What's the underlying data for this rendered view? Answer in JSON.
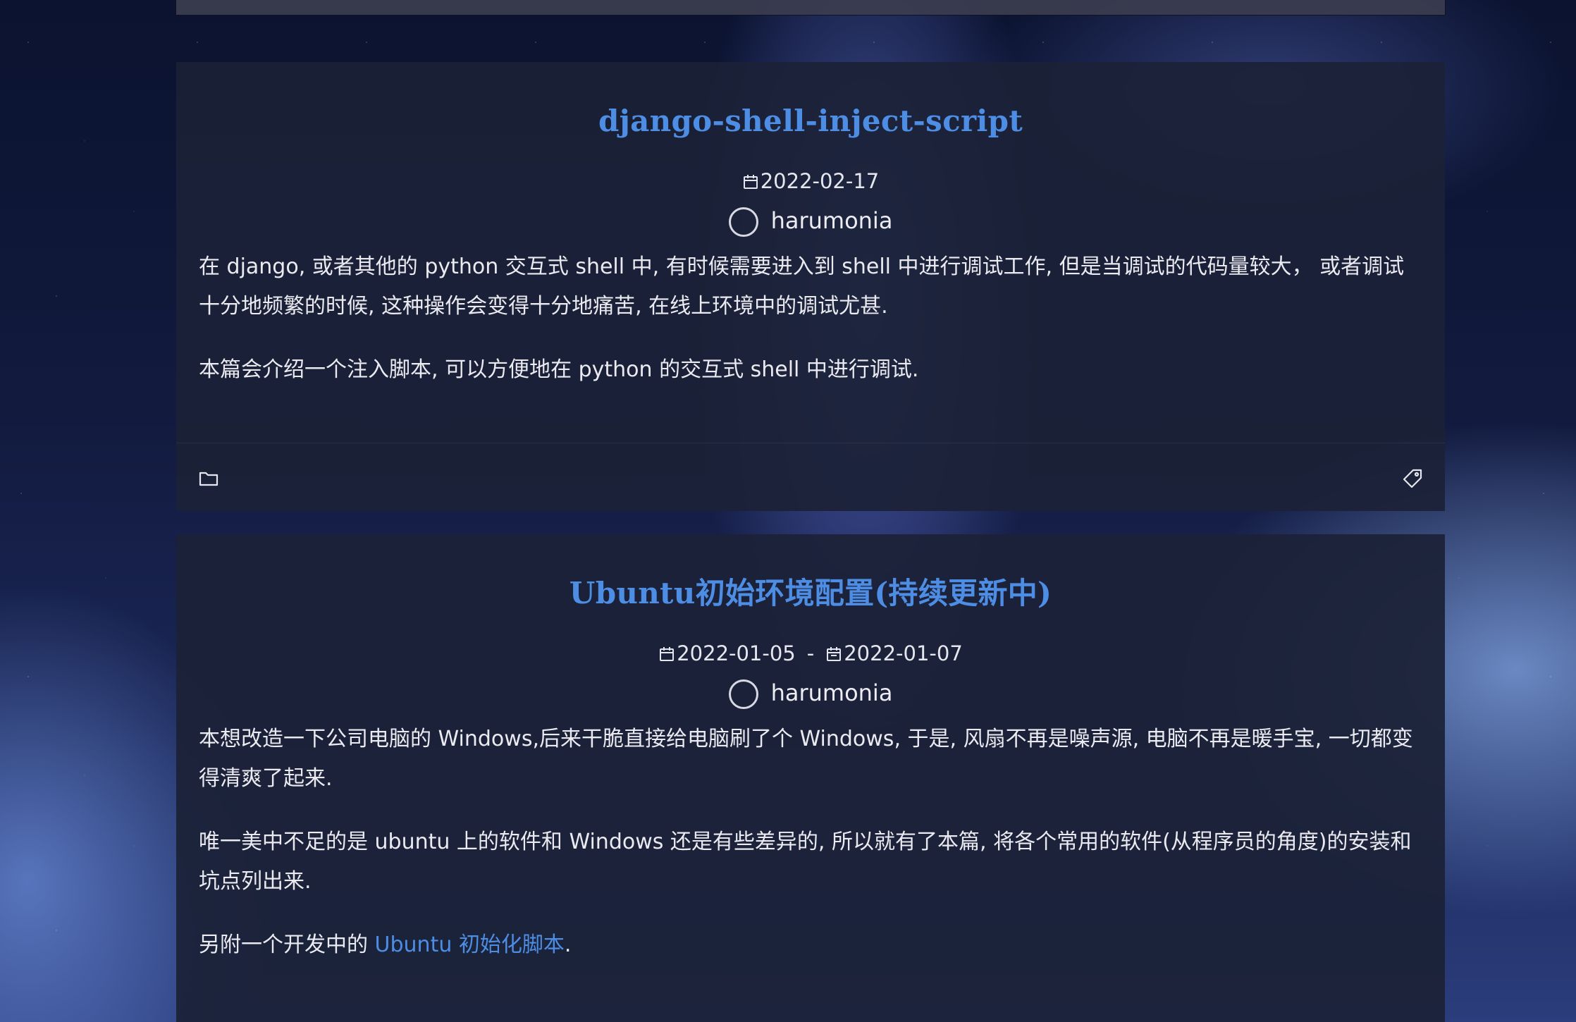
{
  "posts": [
    {
      "title": "django-shell-inject-script",
      "date_created": "2022-02-17",
      "author": "harumonia",
      "paragraphs": [
        "在 django, 或者其他的 python 交互式 shell 中, 有时候需要进入到 shell 中进行调试工作, 但是当调试的代码量较大， 或者调试十分地频繁的时候, 这种操作会变得十分地痛苦, 在线上环境中的调试尤甚.",
        "本篇会介绍一个注入脚本, 可以方便地在 python 的交互式 shell 中进行调试."
      ]
    },
    {
      "title": "Ubuntu初始环境配置(持续更新中)",
      "date_created": "2022-01-05",
      "date_separator": "-",
      "date_updated": "2022-01-07",
      "author": "harumonia",
      "paragraphs": [
        "本想改造一下公司电脑的 Windows,后来干脆直接给电脑刷了个 Windows, 于是, 风扇不再是噪声源, 电脑不再是暖手宝, 一切都变得清爽了起来.",
        "唯一美中不足的是 ubuntu 上的软件和 Windows 还是有些差异的, 所以就有了本篇, 将各个常用的软件(从程序员的角度)的安装和坑点列出来."
      ],
      "last_paragraph_prefix": "另附一个开发中的 ",
      "last_paragraph_link": "Ubuntu 初始化脚本",
      "last_paragraph_suffix": "."
    }
  ],
  "icons": {
    "date": "calendar-icon",
    "author": "avatar-circle",
    "category": "folder-icon",
    "tags": "tag-icon"
  },
  "colors": {
    "title": "#4d8de4",
    "link": "#4d8de4",
    "card_background": "#1b2137",
    "text": "#eaeaf0"
  }
}
